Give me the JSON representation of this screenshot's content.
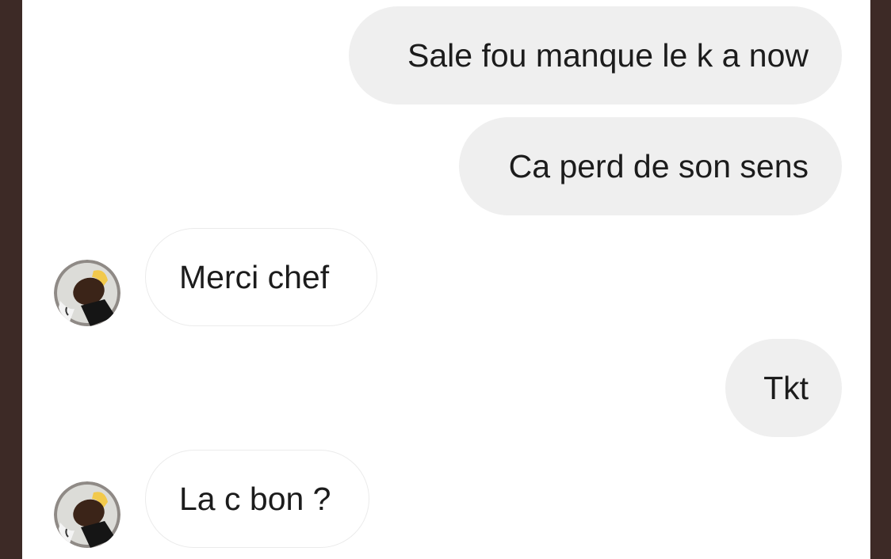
{
  "conversation": {
    "messages": [
      {
        "direction": "sent",
        "text": "Sale fou manque le k a now"
      },
      {
        "direction": "sent",
        "text": "Ca perd de son sens"
      },
      {
        "direction": "received",
        "text": "Merci chef",
        "avatar": "contact-avatar"
      },
      {
        "direction": "sent",
        "text": "Tkt"
      },
      {
        "direction": "received",
        "text": "La c bon ?",
        "avatar": "contact-avatar"
      }
    ]
  },
  "colors": {
    "outer_background": "#3d2a26",
    "chat_background": "#ffffff",
    "sent_bubble": "#efefef",
    "received_bubble_border": "#ebebeb",
    "text": "#1c1c1c"
  }
}
